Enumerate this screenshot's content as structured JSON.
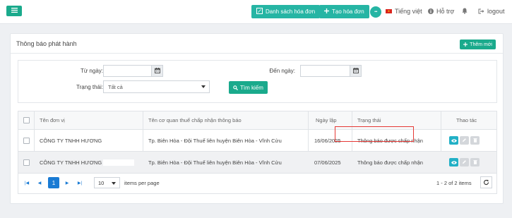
{
  "topbar": {
    "invoice_list_label": "Danh sách hóa đơn",
    "create_invoice_label": "Tạo hóa đơn",
    "more_label": "•••",
    "language_label": "Tiếng việt",
    "support_label": "Hỗ trợ",
    "logout_label": "logout"
  },
  "panel": {
    "title": "Thông báo phát hành",
    "add_new_label": "Thêm mới"
  },
  "filters": {
    "from_date_label": "Từ ngày:",
    "from_date_value": "",
    "to_date_label": "Đến ngày:",
    "to_date_value": "",
    "status_label": "Trạng thái:",
    "status_value": "Tất cả",
    "search_label": "Tìm kiếm"
  },
  "table": {
    "columns": [
      "Tên đơn vị",
      "Tên cơ quan thuế chấp nhận thông báo",
      "Ngày lập",
      "Trạng thái",
      "Thao tác"
    ],
    "rows": [
      {
        "unit": "CÔNG TY TNHH HƯƠNG",
        "tax_office": "Tp. Biên Hòa - Đội Thuế liên huyện Biên Hòa - Vĩnh Cửu",
        "date": "16/06/2025",
        "status": "Thông báo được chấp nhận"
      },
      {
        "unit": "CÔNG TY TNHH HƯƠNG",
        "tax_office": "Tp. Biên Hòa - Đội Thuế liên huyện Biên Hòa - Vĩnh Cửu",
        "date": "07/06/2025",
        "status": "Thông báo được chấp nhận"
      }
    ]
  },
  "pager": {
    "current_page": "1",
    "page_size": "10",
    "items_per_page_label": "items per page",
    "summary": "1 - 2 of 2 items"
  },
  "colors": {
    "teal": "#26b5a4",
    "primary_blue": "#1a7bd4",
    "highlight_red": "#e53935"
  }
}
